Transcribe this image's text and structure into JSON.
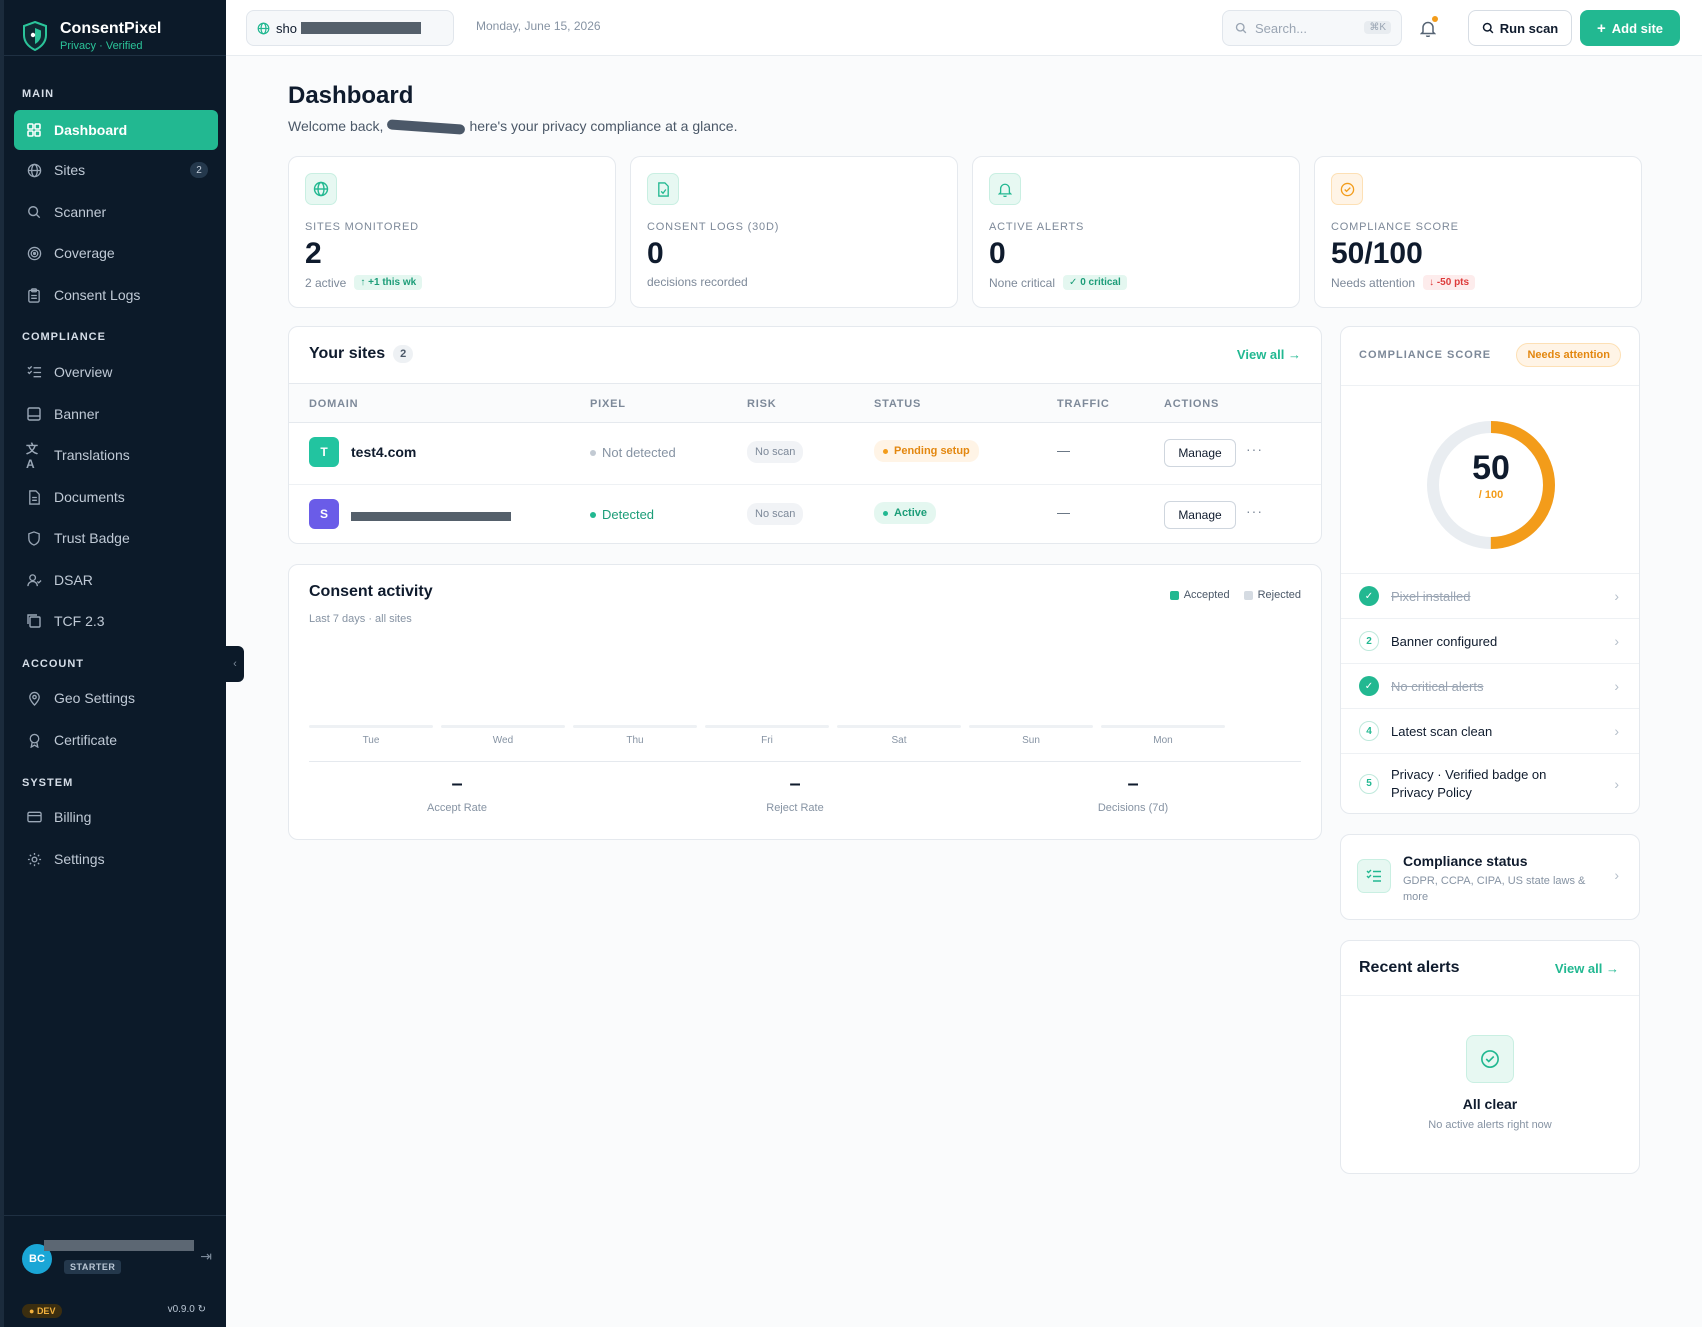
{
  "brand": {
    "name": "ConsentPixel",
    "tagline": "Privacy · Verified"
  },
  "sidebar": {
    "sections": [
      {
        "title": "MAIN"
      },
      {
        "title": "COMPLIANCE"
      },
      {
        "title": "ACCOUNT"
      },
      {
        "title": "SYSTEM"
      }
    ],
    "items": [
      {
        "label": "Dashboard",
        "icon": "grid-icon",
        "active": true
      },
      {
        "label": "Sites",
        "icon": "globe-icon",
        "badge": "2"
      },
      {
        "label": "Scanner",
        "icon": "search-icon"
      },
      {
        "label": "Coverage",
        "icon": "target-icon"
      },
      {
        "label": "Consent Logs",
        "icon": "clipboard-icon"
      },
      {
        "label": "Overview",
        "icon": "list-check-icon"
      },
      {
        "label": "Banner",
        "icon": "banner-icon"
      },
      {
        "label": "Translations",
        "icon": "translate-icon"
      },
      {
        "label": "Documents",
        "icon": "document-icon"
      },
      {
        "label": "Trust Badge",
        "icon": "shield-icon"
      },
      {
        "label": "DSAR",
        "icon": "user-request-icon"
      },
      {
        "label": "TCF 2.3",
        "icon": "tcf-icon"
      },
      {
        "label": "Geo Settings",
        "icon": "map-pin-icon"
      },
      {
        "label": "Certificate",
        "icon": "award-icon"
      },
      {
        "label": "Billing",
        "icon": "credit-card-icon"
      },
      {
        "label": "Settings",
        "icon": "gear-icon"
      }
    ],
    "user": {
      "initials": "BC",
      "plan": "STARTER"
    },
    "env_badge": "DEV",
    "version": "v0.9.0"
  },
  "topbar": {
    "site_picker_prefix": "sho",
    "date": "Monday, June 15, 2026",
    "search_placeholder": "Search...",
    "search_shortcut": "⌘K",
    "run_scan": "Run scan",
    "add_site": "Add site"
  },
  "page": {
    "title": "Dashboard",
    "welcome_start": "Welcome back,",
    "welcome_end": "here's your privacy compliance at a glance."
  },
  "stats": [
    {
      "label": "SITES MONITORED",
      "value": "2",
      "sub": "2 active",
      "pill": "↑ +1 this wk",
      "pill_type": "green",
      "icon": "globe-icon",
      "accent": "#22b891"
    },
    {
      "label": "CONSENT LOGS (30D)",
      "value": "0",
      "sub": "decisions recorded",
      "pill": "",
      "pill_type": "",
      "icon": "document-icon",
      "accent": "#22b891"
    },
    {
      "label": "ACTIVE ALERTS",
      "value": "0",
      "sub": "None critical",
      "pill": "✓ 0 critical",
      "pill_type": "green",
      "icon": "bell-icon",
      "accent": "#22b891"
    },
    {
      "label": "COMPLIANCE SCORE",
      "value": "50/100",
      "sub": "Needs attention",
      "pill": "↓ -50 pts",
      "pill_type": "red",
      "icon": "check-circle-icon",
      "accent": "#f39c1a"
    }
  ],
  "sites": {
    "title": "Your sites",
    "count": "2",
    "view_all": "View all →",
    "columns": [
      "DOMAIN",
      "PIXEL",
      "RISK",
      "STATUS",
      "TRAFFIC",
      "ACTIONS"
    ],
    "rows": [
      {
        "initial": "T",
        "color": "#22c4a0",
        "domain": "test4.com",
        "pixel": "Not detected",
        "risk": "No scan",
        "status": "Pending setup",
        "traffic": "—",
        "action": "Manage"
      },
      {
        "initial": "S",
        "color": "#6a5ce8",
        "domain": "",
        "pixel": "Detected",
        "risk": "No scan",
        "status": "Active",
        "traffic": "—",
        "action": "Manage"
      }
    ]
  },
  "activity": {
    "title": "Consent activity",
    "subtitle": "Last 7 days · all sites",
    "legend": [
      "Accepted",
      "Rejected"
    ],
    "days": [
      "Tue",
      "Wed",
      "Thu",
      "Fri",
      "Sat",
      "Sun",
      "Mon"
    ],
    "metrics": [
      {
        "value": "–",
        "label": "Accept Rate"
      },
      {
        "value": "–",
        "label": "Reject Rate"
      },
      {
        "value": "–",
        "label": "Decisions (7d)"
      }
    ]
  },
  "chart_data": {
    "type": "bar",
    "title": "Consent activity",
    "subtitle": "Last 7 days · all sites",
    "categories": [
      "Tue",
      "Wed",
      "Thu",
      "Fri",
      "Sat",
      "Sun",
      "Mon"
    ],
    "series": [
      {
        "name": "Accepted",
        "values": [
          0,
          0,
          0,
          0,
          0,
          0,
          0
        ],
        "color": "#22b891"
      },
      {
        "name": "Rejected",
        "values": [
          0,
          0,
          0,
          0,
          0,
          0,
          0
        ],
        "color": "#d5dbe2"
      }
    ],
    "legend": "top-right",
    "grid": false
  },
  "score": {
    "heading": "COMPLIANCE SCORE",
    "badge": "Needs attention",
    "value": "50",
    "of": "/ 100",
    "fraction": 0.5,
    "checklist": [
      {
        "label": "Pixel installed",
        "done": true,
        "num": "1"
      },
      {
        "label": "Banner configured",
        "done": false,
        "num": "2"
      },
      {
        "label": "No critical alerts",
        "done": true,
        "num": "3"
      },
      {
        "label": "Latest scan clean",
        "done": false,
        "num": "4"
      },
      {
        "label": "Privacy · Verified badge on Privacy Policy",
        "done": false,
        "num": "5"
      }
    ]
  },
  "compliance_status": {
    "title": "Compliance status",
    "desc": "GDPR, CCPA, CIPA, US state laws & more"
  },
  "alerts": {
    "title": "Recent alerts",
    "view_all": "View all →",
    "empty_title": "All clear",
    "empty_sub": "No active alerts right now"
  }
}
